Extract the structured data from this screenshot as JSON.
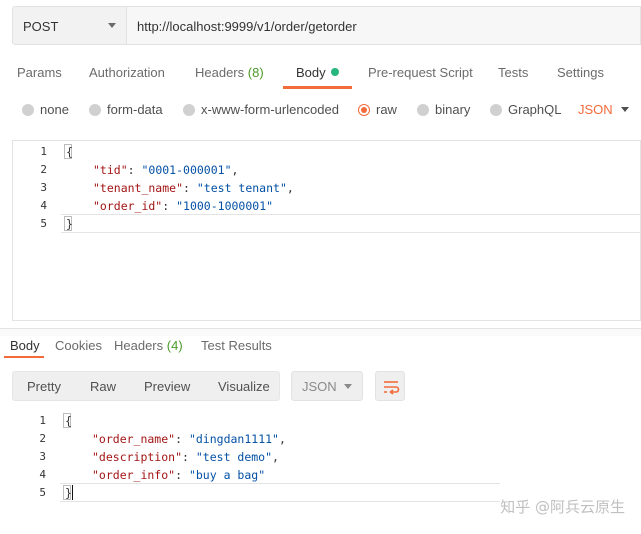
{
  "request": {
    "method": "POST",
    "url": "http://localhost:9999/v1/order/getorder"
  },
  "tabs": [
    {
      "label": "Params"
    },
    {
      "label": "Authorization"
    },
    {
      "label": "Headers",
      "count": "(8)"
    },
    {
      "label": "Body",
      "active": true
    },
    {
      "label": "Pre-request Script"
    },
    {
      "label": "Tests"
    },
    {
      "label": "Settings"
    }
  ],
  "body_types": {
    "options": [
      "none",
      "form-data",
      "x-www-form-urlencoded",
      "raw",
      "binary",
      "GraphQL"
    ],
    "selected": "raw",
    "language": "JSON"
  },
  "request_body": {
    "line_numbers": [
      "1",
      "2",
      "3",
      "4",
      "5"
    ],
    "open": "{",
    "close": "}",
    "fields": [
      {
        "key": "\"tid\"",
        "value": "\"0001-000001\"",
        "sep": ","
      },
      {
        "key": "\"tenant_name\"",
        "value": "\"test tenant\"",
        "sep": ","
      },
      {
        "key": "\"order_id\"",
        "value": "\"1000-1000001\"",
        "sep": ""
      }
    ]
  },
  "response_tabs": [
    {
      "label": "Body",
      "active": true
    },
    {
      "label": "Cookies"
    },
    {
      "label": "Headers",
      "count": "(4)"
    },
    {
      "label": "Test Results"
    }
  ],
  "response_toolbar": {
    "views": [
      "Pretty",
      "Raw",
      "Preview",
      "Visualize"
    ],
    "selected_view": "Pretty",
    "format": "JSON"
  },
  "response_body": {
    "line_numbers": [
      "1",
      "2",
      "3",
      "4",
      "5"
    ],
    "open": "{",
    "close": "}",
    "fields": [
      {
        "key": "\"order_name\"",
        "value": "\"dingdan1111\"",
        "sep": ","
      },
      {
        "key": "\"description\"",
        "value": "\"test demo\"",
        "sep": ","
      },
      {
        "key": "\"order_info\"",
        "value": "\"buy a bag\"",
        "sep": ""
      }
    ]
  },
  "watermark": "知乎 @阿兵云原生",
  "colors": {
    "accent": "#f26b3a",
    "body_dot": "#26b47f",
    "count": "#4c9a2a",
    "json_key": "#a31515",
    "json_string": "#0451a5"
  }
}
